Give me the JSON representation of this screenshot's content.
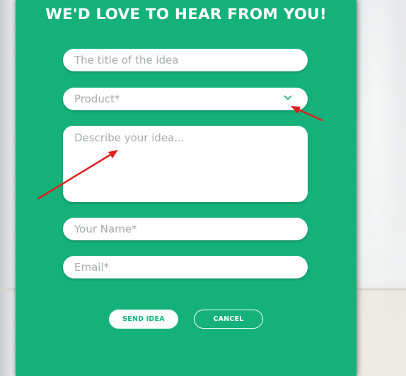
{
  "form": {
    "title": "WE'D LOVE TO HEAR FROM YOU!",
    "fields": {
      "idea_title_placeholder": "The title of the idea",
      "product_placeholder": "Product*",
      "description_placeholder": "Describe your idea...",
      "name_placeholder": "Your Name*",
      "email_placeholder": "Email*"
    },
    "buttons": {
      "send_label": "SEND IDEA",
      "cancel_label": "CANCEL"
    }
  },
  "colors": {
    "panel": "#14b27a",
    "annotation_arrow": "#e0201e"
  },
  "icons": {
    "product_dropdown": "chevron-down-icon"
  }
}
